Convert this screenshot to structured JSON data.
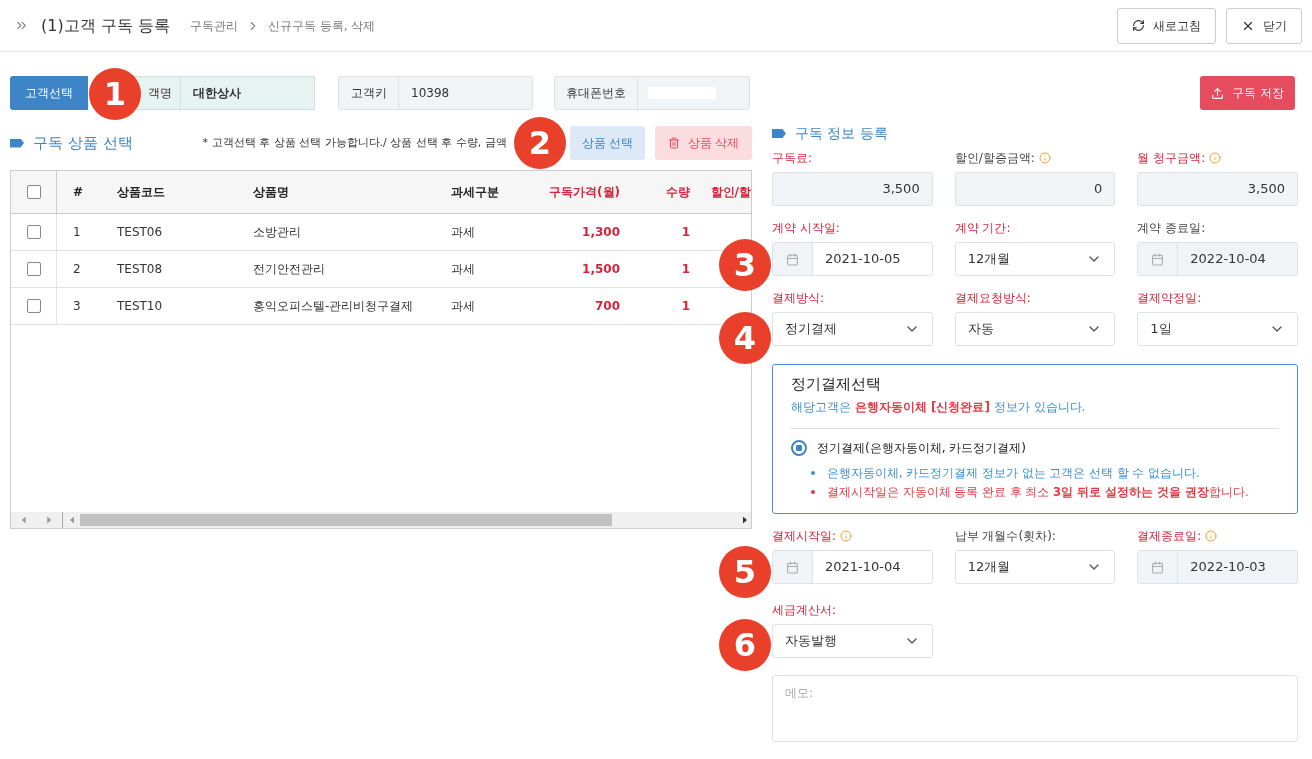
{
  "header": {
    "title": "(1)고객 구독 등록",
    "breadcrumb": [
      "구독관리",
      "신규구독 등록, 삭제"
    ],
    "buttons": [
      {
        "kind": "refresh",
        "label": "새로고침"
      },
      {
        "kind": "close",
        "label": "닫기"
      }
    ]
  },
  "customer": {
    "select_button": "고객선택",
    "name_label": "객명",
    "name_value": "대한상사",
    "key_label": "고객키",
    "key_value": "10398",
    "phone_label": "휴대폰번호",
    "phone_redacted": true
  },
  "save_button": "구독 저장",
  "products": {
    "title": "구독 상품 선택",
    "notice": "* 고객선택 후 상품 선택 가능합니다./ 상품 선택 후 수량, 금액",
    "select_button": "상품 선택",
    "delete_button": "상품 삭제",
    "all_checked": false,
    "columns": [
      {
        "label": "#",
        "red": false
      },
      {
        "label": "상품코드",
        "red": false
      },
      {
        "label": "상품명",
        "red": false
      },
      {
        "label": "과세구분",
        "red": false
      },
      {
        "label": "구독가격(월)",
        "red": true
      },
      {
        "label": "수량",
        "red": true
      },
      {
        "label": "할인/할",
        "red": true
      }
    ],
    "rows": [
      {
        "checked": false,
        "no": "1",
        "code": "TEST06",
        "name": "소방관리",
        "tax": "과세",
        "price": "1,300",
        "qty": "1"
      },
      {
        "checked": false,
        "no": "2",
        "code": "TEST08",
        "name": "전기안전관리",
        "tax": "과세",
        "price": "1,500",
        "qty": "1"
      },
      {
        "checked": false,
        "no": "3",
        "code": "TEST10",
        "name": "홍익오피스텔-관리비청구결제",
        "tax": "과세",
        "price": "700",
        "qty": "1"
      }
    ]
  },
  "info": {
    "title": "구독 정보 등록",
    "rows": [
      [
        {
          "label": "구독료:",
          "required": true,
          "info": false,
          "kind": "number",
          "value": "3,500",
          "readonly": true
        },
        {
          "label": "할인/할증금액:",
          "required": false,
          "info": true,
          "kind": "number",
          "value": "0",
          "readonly": true
        },
        {
          "label": "월 청구금액:",
          "required": true,
          "info": true,
          "kind": "number",
          "value": "3,500",
          "readonly": true
        }
      ],
      [
        {
          "label": "계약 시작일:",
          "required": true,
          "info": false,
          "kind": "date",
          "value": "2021-10-05",
          "readonly": false
        },
        {
          "label": "계약 기간:",
          "required": true,
          "info": false,
          "kind": "select",
          "value": "12개월",
          "readonly": false
        },
        {
          "label": "계약 종료일:",
          "required": false,
          "info": false,
          "kind": "date",
          "value": "2022-10-04",
          "readonly": true
        }
      ],
      [
        {
          "label": "결제방식:",
          "required": true,
          "info": false,
          "kind": "select",
          "value": "정기결제",
          "readonly": false
        },
        {
          "label": "결제요청방식:",
          "required": true,
          "info": false,
          "kind": "select",
          "value": "자동",
          "readonly": false
        },
        {
          "label": "결제약정일:",
          "required": true,
          "info": false,
          "kind": "select",
          "value": "1일",
          "readonly": false
        }
      ]
    ],
    "billing_box": {
      "title": "정기결제선택",
      "notice": "해당고객은 **은행자동이체 [신청완료]** 정보가 있습니다.",
      "option": {
        "label": "정기결제(은행자동이체, 카드정기결제)",
        "selected": true
      },
      "bullets": [
        {
          "text": "은행자동이체, 카드정기결제 정보가 없는 고객은 선택 할 수 없습니다.",
          "color": "#3b8fd6"
        },
        {
          "text": "결제시작일은 자동이체 등록 완료 후 최소 **3일 뒤로 설정하는 것을 권장**합니다.",
          "color": "#e53945"
        }
      ]
    },
    "rows2": [
      [
        {
          "label": "결제시작일:",
          "required": true,
          "info": true,
          "kind": "date",
          "value": "2021-10-04",
          "readonly": false
        },
        {
          "label": "납부 개월수(횟차):",
          "required": false,
          "info": false,
          "kind": "select",
          "value": "12개월",
          "readonly": false
        },
        {
          "label": "결제종료일:",
          "required": true,
          "info": true,
          "kind": "date",
          "value": "2022-10-03",
          "readonly": true
        }
      ],
      [
        {
          "label": "세금계산서:",
          "required": true,
          "info": false,
          "kind": "select",
          "value": "자동발행",
          "readonly": false
        }
      ]
    ],
    "memo": {
      "placeholder": "메모:"
    }
  },
  "markers": [
    {
      "label": "1"
    },
    {
      "label": "2"
    },
    {
      "label": "3"
    },
    {
      "label": "4"
    },
    {
      "label": "5"
    },
    {
      "label": "6"
    }
  ]
}
